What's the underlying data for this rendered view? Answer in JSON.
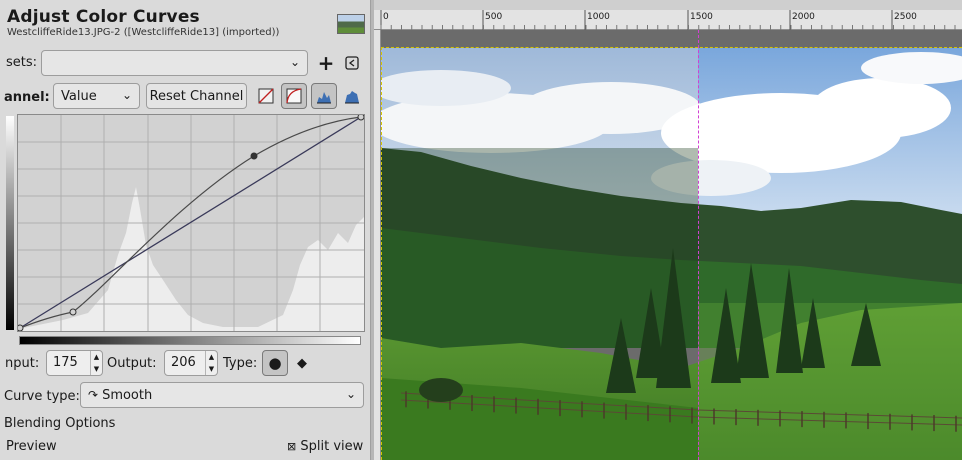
{
  "dialog": {
    "title": "Adjust Color Curves",
    "subtitle": "WestcliffeRide13.JPG-2 ([WestcliffeRide13] (imported))"
  },
  "presets": {
    "label": "sets:",
    "value": ""
  },
  "channel": {
    "label": "annel:",
    "value": "Value",
    "reset_label": "Reset Channel"
  },
  "point": {
    "input_label": "nput:",
    "input_value": "175",
    "output_label": "Output:",
    "output_value": "206",
    "type_label": "Type:"
  },
  "curve_type": {
    "label": "Curve type:",
    "value": "Smooth"
  },
  "blending_label": "Blending Options",
  "preview_label": "Preview",
  "split_view_label": "Split view",
  "ruler": {
    "labels": [
      "0",
      "500",
      "1000",
      "1500",
      "2000",
      "2500"
    ]
  },
  "curve": {
    "control_points": [
      [
        0,
        0
      ],
      [
        30,
        15
      ],
      [
        175,
        206
      ],
      [
        255,
        255
      ]
    ]
  },
  "colors": {
    "sky": "#b7cde8",
    "hills": "#2f5230",
    "meadow": "#4d8a2e",
    "split_line": "#d23fd2",
    "selection": "#d4c400"
  },
  "icons": [
    "plus-icon",
    "save-preset-icon",
    "chevron-down-icon",
    "linear-histogram-icon",
    "log-histogram-icon",
    "square-node-icon",
    "diamond-node-icon",
    "smooth-curve-icon",
    "checkbox-icon"
  ]
}
